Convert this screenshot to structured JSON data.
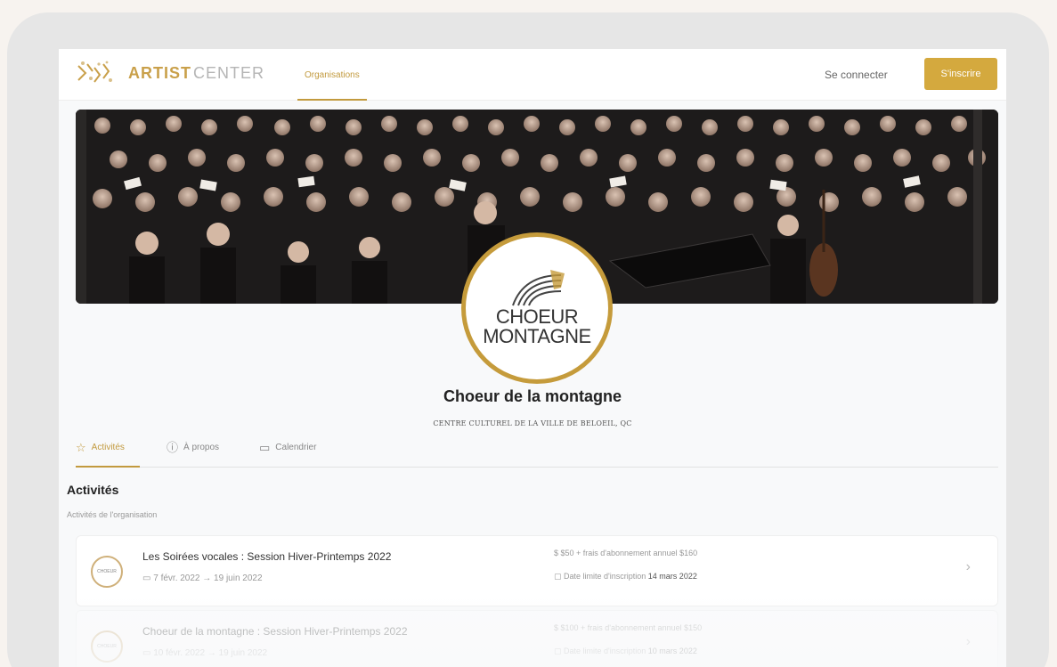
{
  "header": {
    "brand_part1": "ARTIST",
    "brand_part2": "CENTER",
    "nav_tab": "Organisations",
    "login_label": "Se connecter",
    "signup_label": "S'inscrire"
  },
  "organization": {
    "logo_line1": "CHOEUR",
    "logo_line2": "MONTAGNE",
    "name": "Choeur de la montagne",
    "location": "CENTRE CULTUREL DE LA VILLE DE BELOEIL, QC"
  },
  "tabs": [
    {
      "label": "Activités",
      "icon": "star-icon",
      "active": true
    },
    {
      "label": "À propos",
      "icon": "info-icon",
      "active": false
    },
    {
      "label": "Calendrier",
      "icon": "calendar-icon",
      "active": false
    }
  ],
  "section": {
    "title": "Activités",
    "subtitle": "Activités de l'organisation"
  },
  "activities": [
    {
      "title": "Les Soirées vocales : Session Hiver-Printemps 2022",
      "dates": "7 févr. 2022 → 19 juin 2022",
      "price": "$50 + frais d'abonnement annuel $160",
      "deadline_label": "Date limite d'inscription",
      "deadline_value": "14 mars 2022"
    },
    {
      "title": "Choeur de la montagne : Session Hiver-Printemps 2022",
      "dates": "10 févr. 2022 → 19 juin 2022",
      "price": "$100 + frais d'abonnement annuel $150",
      "deadline_label": "Date limite d'inscription",
      "deadline_value": "10 mars 2022"
    }
  ],
  "colors": {
    "accent": "#c29a3e",
    "button": "#d4a93e",
    "text": "#2b2b2b"
  }
}
